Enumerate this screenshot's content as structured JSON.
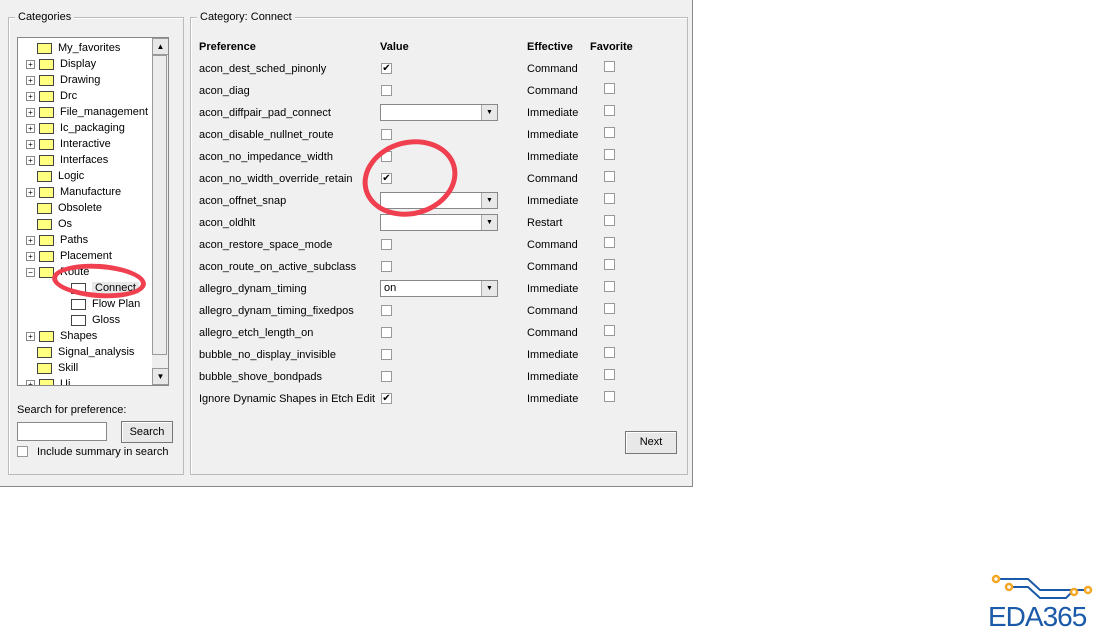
{
  "categories": {
    "title": "Categories",
    "items": [
      {
        "label": "My_favorites",
        "expand": ""
      },
      {
        "label": "Display",
        "expand": "+"
      },
      {
        "label": "Drawing",
        "expand": "+"
      },
      {
        "label": "Drc",
        "expand": "+"
      },
      {
        "label": "File_management",
        "expand": "+"
      },
      {
        "label": "Ic_packaging",
        "expand": "+"
      },
      {
        "label": "Interactive",
        "expand": "+"
      },
      {
        "label": "Interfaces",
        "expand": "+"
      },
      {
        "label": "Logic",
        "expand": ""
      },
      {
        "label": "Manufacture",
        "expand": "+"
      },
      {
        "label": "Obsolete",
        "expand": ""
      },
      {
        "label": "Os",
        "expand": ""
      },
      {
        "label": "Paths",
        "expand": "+"
      },
      {
        "label": "Placement",
        "expand": "+"
      },
      {
        "label": "Route",
        "expand": "−"
      },
      {
        "label": "Connect",
        "expand": "",
        "child": true,
        "selected": true
      },
      {
        "label": "Flow Plan",
        "expand": "",
        "child": true
      },
      {
        "label": "Gloss",
        "expand": "",
        "child": true
      },
      {
        "label": "Shapes",
        "expand": "+"
      },
      {
        "label": "Signal_analysis",
        "expand": ""
      },
      {
        "label": "Skill",
        "expand": ""
      },
      {
        "label": "Ui",
        "expand": "+"
      }
    ]
  },
  "search": {
    "label": "Search for preference:",
    "value": "",
    "button": "Search",
    "include_summary": "Include summary in search"
  },
  "panel": {
    "title": "Category:  Connect",
    "headers": {
      "preference": "Preference",
      "value": "Value",
      "effective": "Effective",
      "favorite": "Favorite"
    },
    "rows": [
      {
        "name": "acon_dest_sched_pinonly",
        "type": "check",
        "checked": true,
        "effective": "Command"
      },
      {
        "name": "acon_diag",
        "type": "check",
        "checked": false,
        "effective": "Command"
      },
      {
        "name": "acon_diffpair_pad_connect",
        "type": "dropdown",
        "value": "",
        "effective": "Immediate"
      },
      {
        "name": "acon_disable_nullnet_route",
        "type": "check",
        "checked": false,
        "effective": "Immediate"
      },
      {
        "name": "acon_no_impedance_width",
        "type": "check",
        "checked": false,
        "effective": "Immediate"
      },
      {
        "name": "acon_no_width_override_retain",
        "type": "check",
        "checked": true,
        "effective": "Command"
      },
      {
        "name": "acon_offnet_snap",
        "type": "dropdown",
        "value": "",
        "effective": "Immediate"
      },
      {
        "name": "acon_oldhlt",
        "type": "dropdown",
        "value": "",
        "effective": "Restart"
      },
      {
        "name": "acon_restore_space_mode",
        "type": "check",
        "checked": false,
        "effective": "Command"
      },
      {
        "name": "acon_route_on_active_subclass",
        "type": "check",
        "checked": false,
        "effective": "Command"
      },
      {
        "name": "allegro_dynam_timing",
        "type": "dropdown",
        "value": "on",
        "effective": "Immediate"
      },
      {
        "name": "allegro_dynam_timing_fixedpos",
        "type": "check",
        "checked": false,
        "effective": "Command"
      },
      {
        "name": "allegro_etch_length_on",
        "type": "check",
        "checked": false,
        "effective": "Command"
      },
      {
        "name": "bubble_no_display_invisible",
        "type": "check",
        "checked": false,
        "effective": "Immediate"
      },
      {
        "name": "bubble_shove_bondpads",
        "type": "check",
        "checked": false,
        "effective": "Immediate"
      },
      {
        "name": "Ignore Dynamic Shapes in Etch Edit",
        "type": "check",
        "checked": true,
        "effective": "Immediate"
      }
    ],
    "next": "Next"
  },
  "logo": {
    "text": "EDA365",
    "colors": {
      "blue": "#1a5aa8",
      "orange": "#f5a623"
    }
  }
}
